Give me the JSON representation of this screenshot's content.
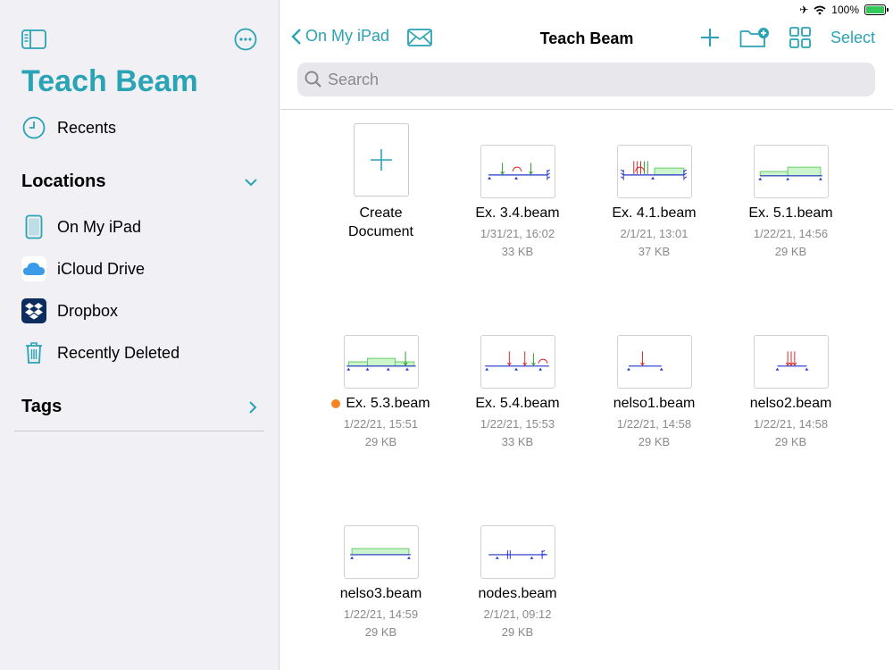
{
  "status": {
    "battery": "100%"
  },
  "sidebar": {
    "title": "Teach Beam",
    "recents": "Recents",
    "locations_header": "Locations",
    "locations": [
      "On My iPad",
      "iCloud Drive",
      "Dropbox",
      "Recently Deleted"
    ],
    "tags_header": "Tags"
  },
  "nav": {
    "back_label": "On My iPad",
    "title": "Teach Beam",
    "select_label": "Select"
  },
  "search": {
    "placeholder": "Search"
  },
  "create": {
    "line1": "Create",
    "line2": "Document"
  },
  "files": [
    {
      "name": "Ex. 3.4.beam",
      "date": "1/31/21, 16:02",
      "size": "33 KB"
    },
    {
      "name": "Ex. 4.1.beam",
      "date": "2/1/21, 13:01",
      "size": "37 KB"
    },
    {
      "name": "Ex. 5.1.beam",
      "date": "1/22/21, 14:56",
      "size": "29 KB"
    },
    {
      "name": "Ex. 5.3.beam",
      "date": "1/22/21, 15:51",
      "size": "29 KB",
      "tag_color": "#f5851f"
    },
    {
      "name": "Ex. 5.4.beam",
      "date": "1/22/21, 15:53",
      "size": "33 KB"
    },
    {
      "name": "nelso1.beam",
      "date": "1/22/21, 14:58",
      "size": "29 KB"
    },
    {
      "name": "nelso2.beam",
      "date": "1/22/21, 14:58",
      "size": "29 KB"
    },
    {
      "name": "nelso3.beam",
      "date": "1/22/21, 14:59",
      "size": "29 KB"
    },
    {
      "name": "nodes.beam",
      "date": "2/1/21, 09:12",
      "size": "29 KB"
    }
  ],
  "colors": {
    "accent": "#2aa3b5",
    "tag_orange": "#f5851f"
  }
}
